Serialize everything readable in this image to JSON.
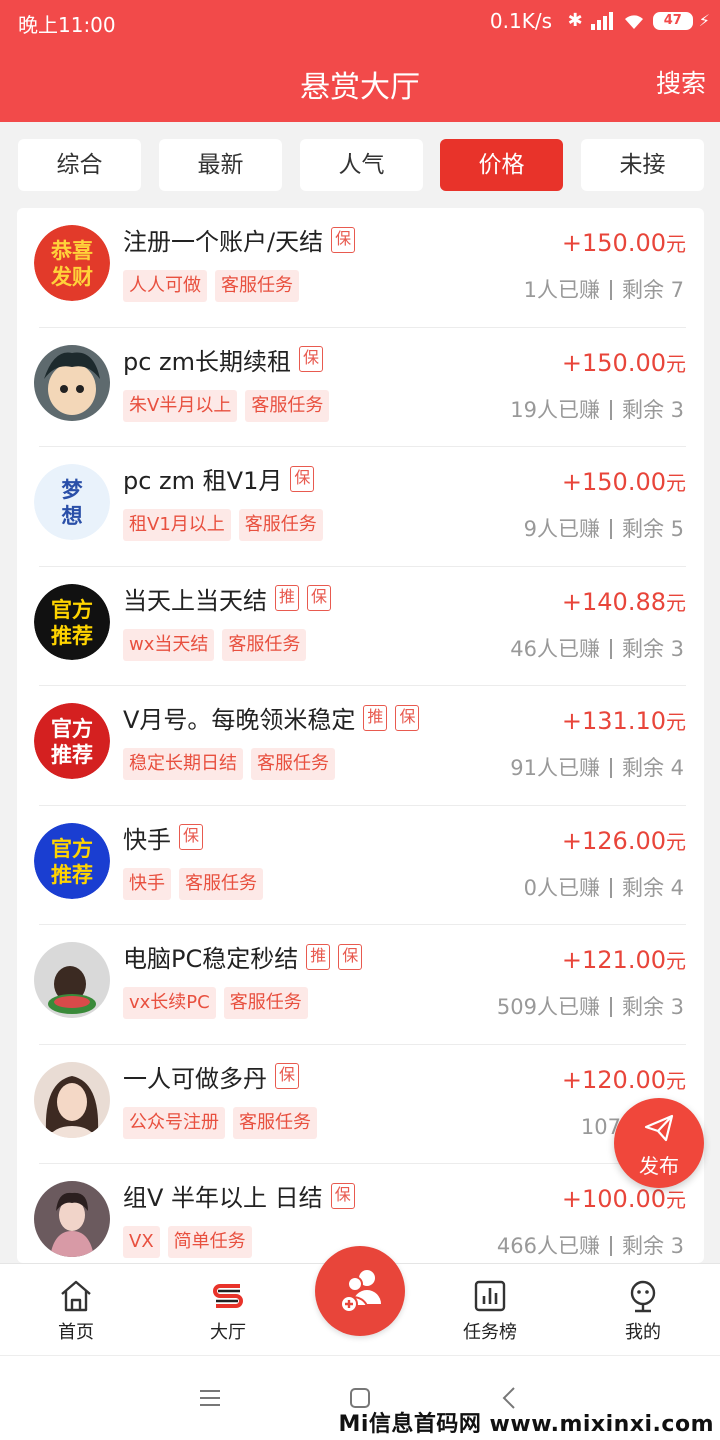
{
  "status_bar": {
    "time": "晚上11:00",
    "network_speed": "0.1K/s",
    "battery": "47"
  },
  "header": {
    "title": "悬赏大厅",
    "search": "搜索"
  },
  "tabs": [
    {
      "label": "综合",
      "active": false
    },
    {
      "label": "最新",
      "active": false
    },
    {
      "label": "人气",
      "active": false
    },
    {
      "label": "价格",
      "active": true
    },
    {
      "label": "未接",
      "active": false
    }
  ],
  "tasks": [
    {
      "title": "注册一个账户/天结",
      "badges": [
        "保"
      ],
      "tags": [
        "人人可做",
        "客服任务"
      ],
      "price": "+150.00",
      "unit": "元",
      "earned": "1人已赚",
      "remaining": "剩余 7",
      "avatar_text": [
        "恭喜",
        "发财"
      ]
    },
    {
      "title": "pc zm长期续租",
      "badges": [
        "保"
      ],
      "tags": [
        "朱V半月以上",
        "客服任务"
      ],
      "price": "+150.00",
      "unit": "元",
      "earned": "19人已赚",
      "remaining": "剩余 3",
      "avatar_text": []
    },
    {
      "title": "pc zm 租V1月",
      "badges": [
        "保"
      ],
      "tags": [
        "租V1月以上",
        "客服任务"
      ],
      "price": "+150.00",
      "unit": "元",
      "earned": "9人已赚",
      "remaining": "剩余 5",
      "avatar_text": [
        "梦",
        "想"
      ]
    },
    {
      "title": "当天上当天结",
      "badges": [
        "推",
        "保"
      ],
      "tags": [
        "wx当天结",
        "客服任务"
      ],
      "price": "+140.88",
      "unit": "元",
      "earned": "46人已赚",
      "remaining": "剩余 3",
      "avatar_text": [
        "官方",
        "推荐"
      ]
    },
    {
      "title": "V月号。每晚领米稳定",
      "badges": [
        "推",
        "保"
      ],
      "tags": [
        "稳定长期日结",
        "客服任务"
      ],
      "price": "+131.10",
      "unit": "元",
      "earned": "91人已赚",
      "remaining": "剩余 4",
      "avatar_text": [
        "官方",
        "推荐"
      ]
    },
    {
      "title": "快手",
      "badges": [
        "保"
      ],
      "tags": [
        "快手",
        "客服任务"
      ],
      "price": "+126.00",
      "unit": "元",
      "earned": "0人已赚",
      "remaining": "剩余 4",
      "avatar_text": [
        "官方",
        "推荐"
      ]
    },
    {
      "title": "电脑PC稳定秒结",
      "badges": [
        "推",
        "保"
      ],
      "tags": [
        "vx长续PC",
        "客服任务"
      ],
      "price": "+121.00",
      "unit": "元",
      "earned": "509人已赚",
      "remaining": "剩余 3",
      "avatar_text": []
    },
    {
      "title": "一人可做多丹",
      "badges": [
        "保"
      ],
      "tags": [
        "公众号注册",
        "客服任务"
      ],
      "price": "+120.00",
      "unit": "元",
      "earned": "107人已赚",
      "remaining": "",
      "avatar_text": []
    },
    {
      "title": "组V 半年以上 日结",
      "badges": [
        "保"
      ],
      "tags": [
        "VX",
        "简单任务"
      ],
      "price": "+100.00",
      "unit": "元",
      "earned": "466人已赚",
      "remaining": "剩余 3",
      "avatar_text": []
    }
  ],
  "fab": {
    "label": "发布"
  },
  "bottom_nav": [
    {
      "label": "首页",
      "icon": "home-icon"
    },
    {
      "label": "大厅",
      "icon": "hall-icon"
    },
    {
      "label": "任务榜",
      "icon": "chart-icon"
    },
    {
      "label": "我的",
      "icon": "profile-icon"
    }
  ],
  "watermark": "Mi信息首码网 www.mixinxi.com",
  "colors": {
    "brand_red": "#f24a4a",
    "active_tab": "#e8332a",
    "price_red": "#e8453a",
    "tag_bg": "#fde9e7"
  }
}
